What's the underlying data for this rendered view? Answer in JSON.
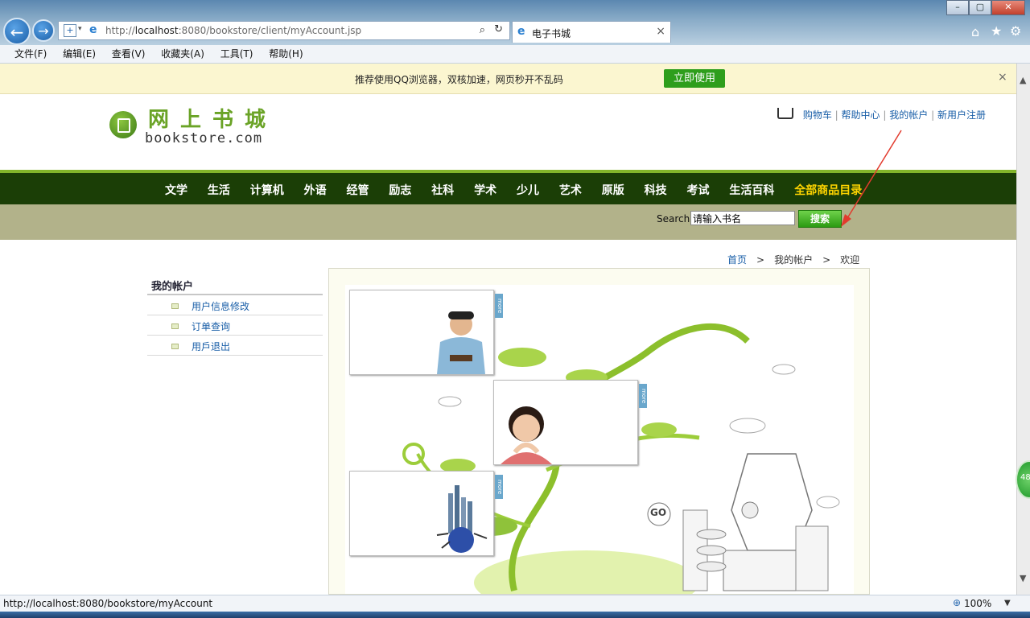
{
  "browser": {
    "url_prefix": "http://",
    "url_host": "localhost",
    "url_rest": ":8080/bookstore/client/myAccount.jsp",
    "tab_title": "电子书城",
    "menu": [
      "文件(F)",
      "编辑(E)",
      "查看(V)",
      "收藏夹(A)",
      "工具(T)",
      "帮助(H)"
    ],
    "status_url": "http://localhost:8080/bookstore/myAccount",
    "zoom": "100%",
    "side_badge": "48"
  },
  "notice": {
    "message": "推荐使用QQ浏览器，双核加速，网页秒开不乱码",
    "button": "立即使用",
    "close": "×"
  },
  "header": {
    "logo_cn": "网上书城",
    "logo_en": "bookstore.com",
    "links": [
      "购物车",
      "帮助中心",
      "我的帐户",
      "新用户注册"
    ],
    "sep": "|"
  },
  "nav": {
    "items": [
      "文学",
      "生活",
      "计算机",
      "外语",
      "经管",
      "励志",
      "社科",
      "学术",
      "少儿",
      "艺术",
      "原版",
      "科技",
      "考试",
      "生活百科"
    ],
    "highlight": "全部商品目录"
  },
  "search": {
    "label": "Search",
    "value": "请输入书名",
    "button": "搜索"
  },
  "breadcrumb": {
    "home": "首页",
    "sep": ">",
    "current": "我的帐户",
    "page": "欢迎"
  },
  "sidebar": {
    "title": "我的帐户",
    "items": [
      "用户信息修改",
      "订单查询",
      "用戶退出"
    ]
  },
  "picture": {
    "more_label": "more",
    "go_label": "GO"
  },
  "colors": {
    "nav_bg": "#1b3e06",
    "nav_accent": "#83b52a",
    "highlight": "#ffd400",
    "link": "#1a5fa8",
    "search_bar": "#b2b28a"
  }
}
